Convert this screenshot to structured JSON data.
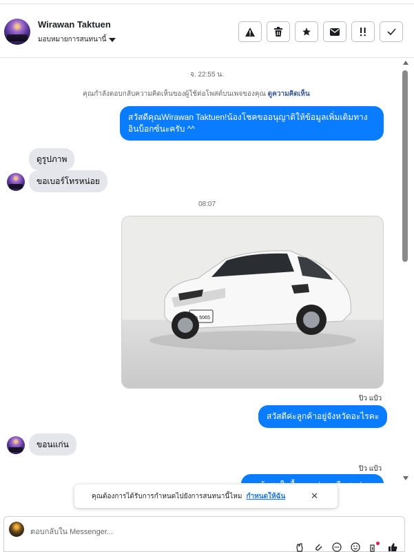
{
  "header": {
    "user_name": "Wirawan Taktuen",
    "assign_label": "มอบหมายการสนทนานี้",
    "actions": [
      {
        "name": "report-spam-button",
        "icon": "warning-icon",
        "glyph": "▲"
      },
      {
        "name": "delete-button",
        "icon": "trash-icon",
        "glyph": "🗑"
      },
      {
        "name": "star-button",
        "icon": "star-icon",
        "glyph": "★"
      },
      {
        "name": "mark-unread-button",
        "icon": "envelope-icon",
        "glyph": "✉"
      },
      {
        "name": "follow-up-button",
        "icon": "flag-icon",
        "glyph": "!!"
      },
      {
        "name": "mark-done-button",
        "icon": "check-icon",
        "glyph": "✓"
      }
    ]
  },
  "thread": {
    "time_1": "จ. 22:55 น.",
    "notice_text": "คุณกำลังตอบกลับความคิดเห็นของผู้ใช้ต่อโพสต์บนเพจของคุณ",
    "notice_link": "ดูความคิดเห็น",
    "msg_out_1": "สวัสดีคุณWirawan Taktuen!น้องโชคขออนุญาติให้ข้อมูลเพิ่มเติมทาง อินบ็อกซ์นะครับ ^^",
    "msg_in_1": "ดูรูปภาพ",
    "msg_in_2": "ขอเบอร์โทรหน่อย",
    "time_2": "08:07",
    "photo_alt": "white sedan photo",
    "seen_1": "ปิว แป้ว",
    "msg_out_2": "สวัสดีค่ะลูกค้าอยู่จังหวัดอะไรคะ",
    "msg_in_3": "ขอนแก่น",
    "seen_2": "ปิว แป้ว",
    "msg_out_3_partial": "ลูกค้าสนใจซื้อแบบผ่อนหรือสดค่ะ"
  },
  "toast": {
    "text": "คุณต้องการได้รับการกำหนดไปยังการสนทนานี้ไหม",
    "link": "กำหนดให้ฉัน",
    "close": "✕"
  },
  "composer": {
    "placeholder": "ตอบกลับใน Messenger...",
    "tools": [
      "hand-icon",
      "paperclip-icon",
      "more-icon",
      "emoji-icon",
      "saved-reply-icon",
      "like-icon"
    ]
  },
  "colors": {
    "outgoing": "#0a7cff",
    "incoming": "#e4e6eb",
    "link": "#385898"
  }
}
